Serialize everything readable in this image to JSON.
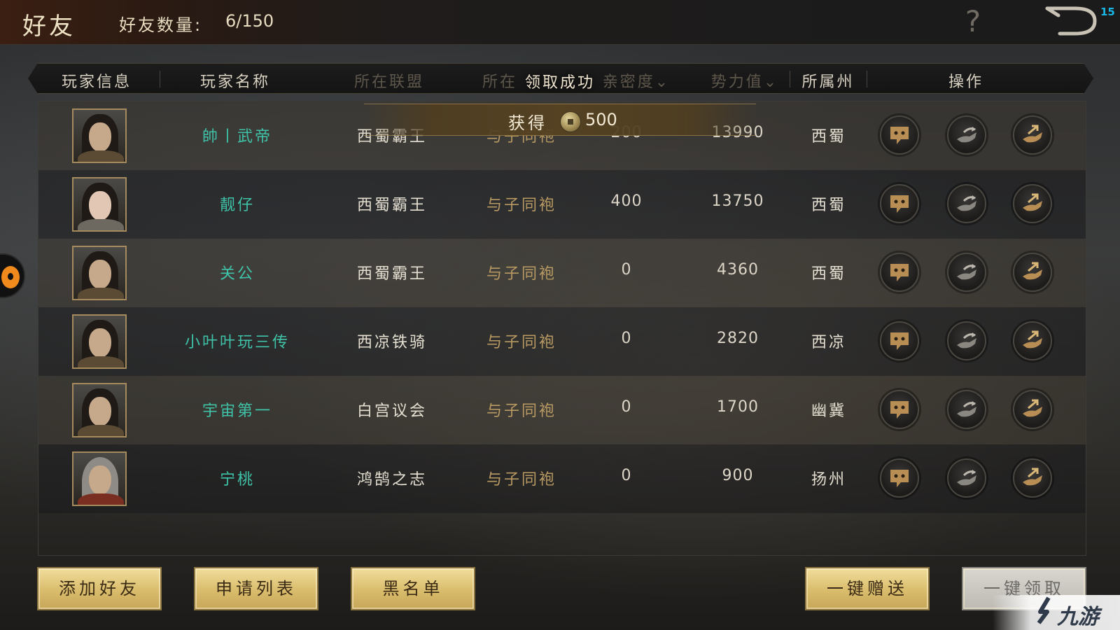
{
  "header": {
    "title": "好友",
    "friend_count_label": "好友数量:",
    "friend_count_value": "6/150",
    "notification_count": "15"
  },
  "columns": {
    "player_info": "玩家信息",
    "player_name": "玩家名称",
    "alliance": "所在联盟",
    "relation": "所在",
    "intimacy": "亲密度",
    "power": "势力值",
    "state": "所属州",
    "actions": "操作"
  },
  "toast": {
    "title": "领取成功",
    "gain_label": "获得",
    "amount": "500"
  },
  "rows": [
    {
      "name": "帥丨武帝",
      "alliance": "西蜀霸王",
      "relation": "与子同袍",
      "intimacy": "200",
      "power": "13990",
      "state": "西蜀"
    },
    {
      "name": "靓仔",
      "alliance": "西蜀霸王",
      "relation": "与子同袍",
      "intimacy": "400",
      "power": "13750",
      "state": "西蜀"
    },
    {
      "name": "关公",
      "alliance": "西蜀霸王",
      "relation": "与子同袍",
      "intimacy": "0",
      "power": "4360",
      "state": "西蜀"
    },
    {
      "name": "小叶叶玩三传",
      "alliance": "西凉铁骑",
      "relation": "与子同袍",
      "intimacy": "0",
      "power": "2820",
      "state": "西凉"
    },
    {
      "name": "宇宙第一",
      "alliance": "白宫议会",
      "relation": "与子同袍",
      "intimacy": "0",
      "power": "1700",
      "state": "幽冀"
    },
    {
      "name": "宁桃",
      "alliance": "鸿鹄之志",
      "relation": "与子同袍",
      "intimacy": "0",
      "power": "900",
      "state": "扬州"
    }
  ],
  "buttons": {
    "add_friend": "添加好友",
    "request_list": "申请列表",
    "blacklist": "黑名单",
    "gift_all": "一键赠送",
    "claim_all": "一键领取"
  },
  "watermark": {
    "text": "九游"
  },
  "icons": {
    "help": "question-mark-icon",
    "back": "back-arrow-icon",
    "chat": "chat-bubble-icon",
    "give": "give-hand-icon",
    "receive": "receive-hand-icon",
    "coin": "copper-coin-icon"
  }
}
